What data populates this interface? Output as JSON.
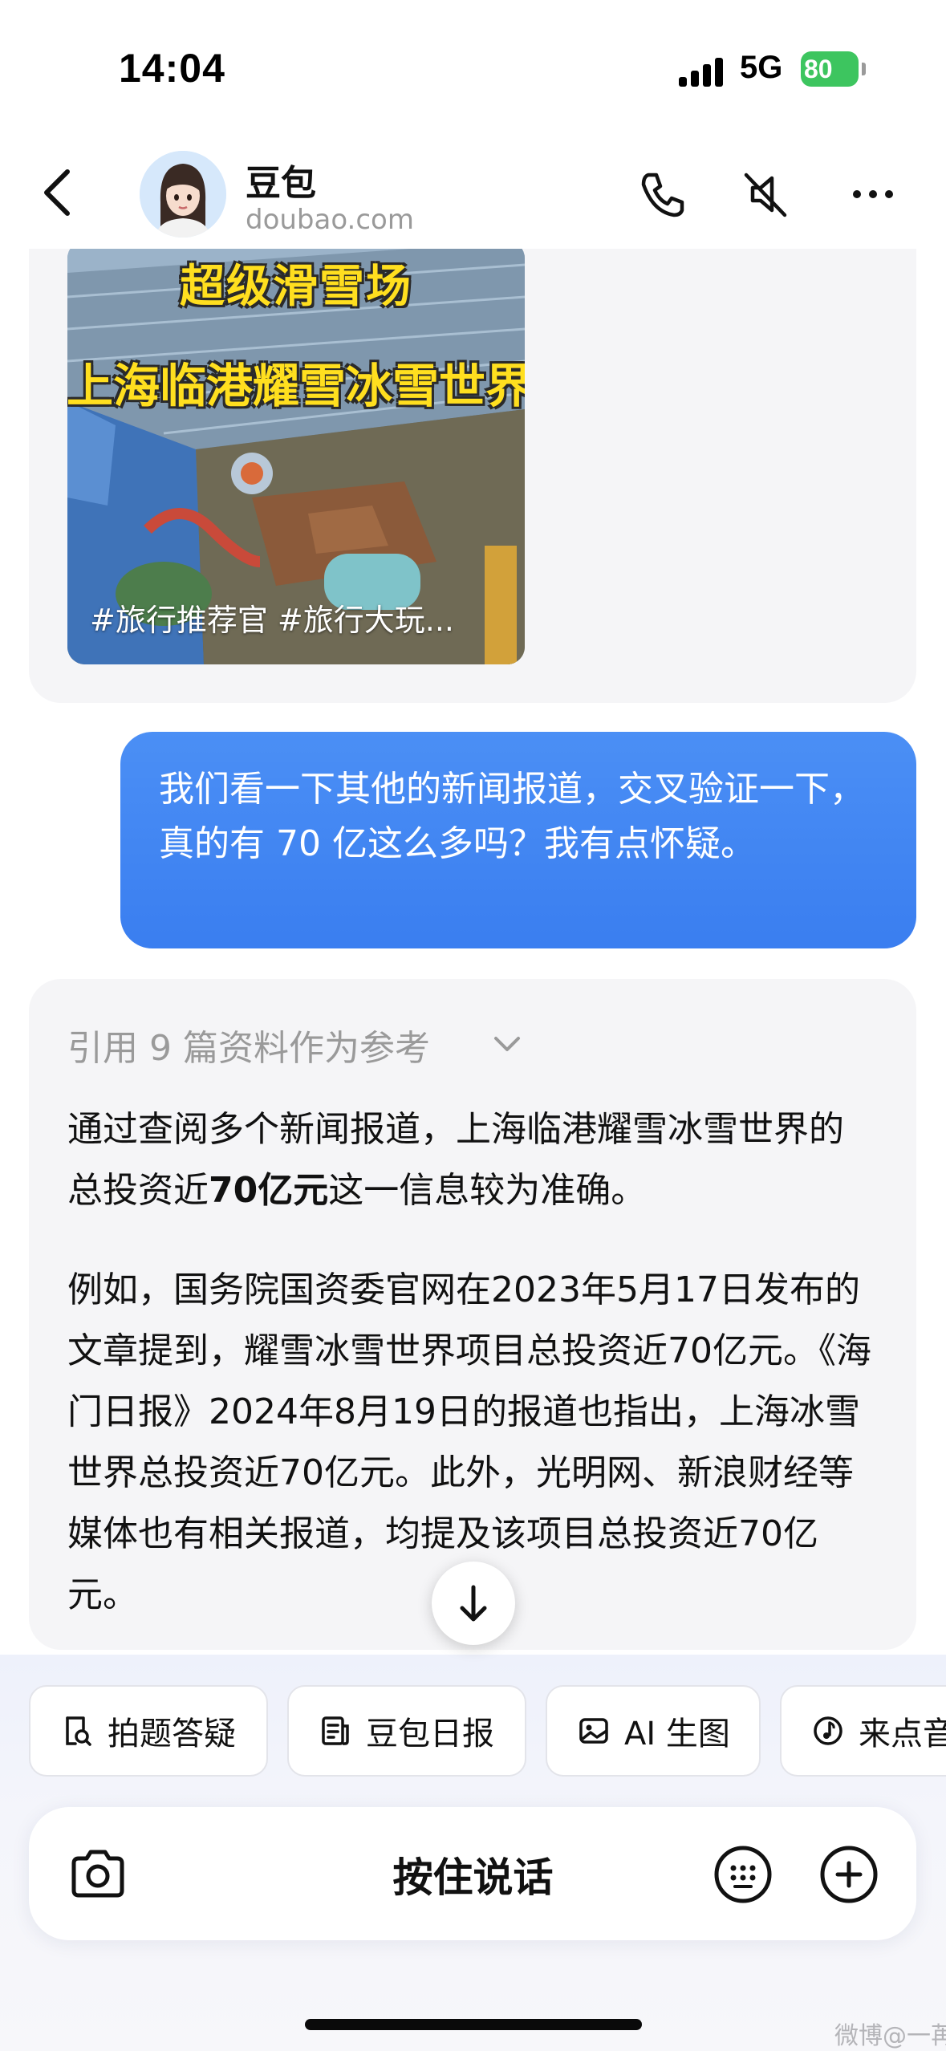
{
  "status_bar": {
    "time": "14:04",
    "network": "5G",
    "battery": "80"
  },
  "header": {
    "bot_name": "豆包",
    "domain": "doubao.com"
  },
  "video_card": {
    "banner_line1": "超级滑雪场",
    "banner_line2": "上海临港耀雪冰雪世界",
    "caption": "#旅行推荐官 #旅行大玩..."
  },
  "user_message": "我们看一下其他的新闻报道，交叉验证一下，真的有 70 亿这么多吗？我有点怀疑。",
  "bot_message": {
    "reference_line": "引用 9 篇资料作为参考",
    "p1_before": "通过查阅多个新闻报道，上海临港耀雪冰雪世界的总投资近",
    "p1_bold": "70亿元",
    "p1_after": "这一信息较为准确。",
    "p2": "例如，国务院国资委官网在2023年5月17日发布的文章提到，耀雪冰雪世界项目总投资近70亿元。《海门日报》2024年8月19日的报道也指出，上海冰雪世界总投资近70亿元。此外，光明网、新浪财经等媒体也有相关报道，均提及该项目总投资近70亿元。"
  },
  "shortcuts": [
    {
      "label": "拍题答疑",
      "icon": "search-doc-icon"
    },
    {
      "label": "豆包日报",
      "icon": "news-icon"
    },
    {
      "label": "AI 生图",
      "icon": "image-icon"
    },
    {
      "label": "来点音",
      "icon": "music-note-icon"
    }
  ],
  "input_bar": {
    "hold_to_talk": "按住说话"
  },
  "watermark": "微博@一苒",
  "colors": {
    "user_bubble": "#3a7ef0",
    "bot_bubble": "#f5f5f7",
    "battery": "#3dc55f"
  }
}
